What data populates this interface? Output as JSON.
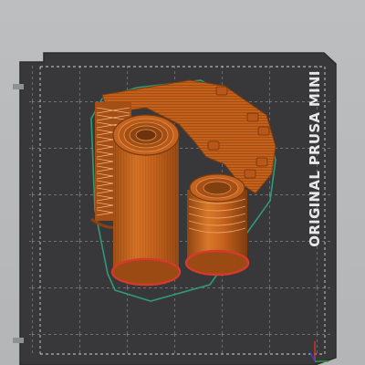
{
  "printer": {
    "bed_label": "ORIGINAL PRUSA MINI"
  },
  "colors": {
    "background": "#b9babc",
    "bed_surface": "#3a3a3c",
    "grid_lines": "#9a9a9a",
    "model_orange": "#c9651e",
    "model_highlight": "#e08a3a",
    "model_shadow": "#8a4410",
    "skirt_outline": "#2a8a6a",
    "brim_red": "#c8302a"
  },
  "icons": [
    "axis-gizmo-icon"
  ]
}
